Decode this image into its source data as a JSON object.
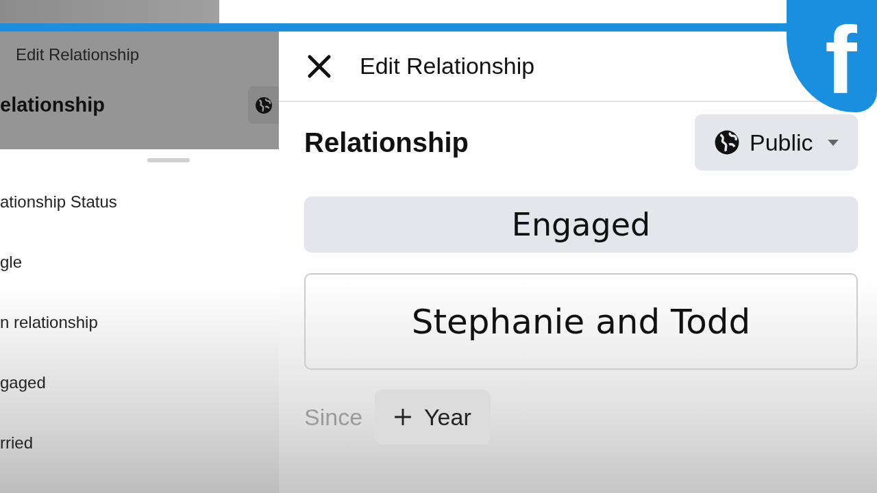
{
  "background_screen": {
    "title": "Edit Relationship",
    "heading": "elationship"
  },
  "status_sheet": {
    "title": "ationship Status",
    "options": [
      {
        "label": "gle"
      },
      {
        "label": "n relationship"
      },
      {
        "label": "gaged"
      },
      {
        "label": "rried"
      }
    ]
  },
  "dialog": {
    "title": "Edit Relationship",
    "heading": "Relationship",
    "audience": "Public",
    "status": "Engaged",
    "partner": "Stephanie and Todd",
    "since_label": "Since",
    "year_button": "Year"
  },
  "logo": {
    "text": "f"
  }
}
